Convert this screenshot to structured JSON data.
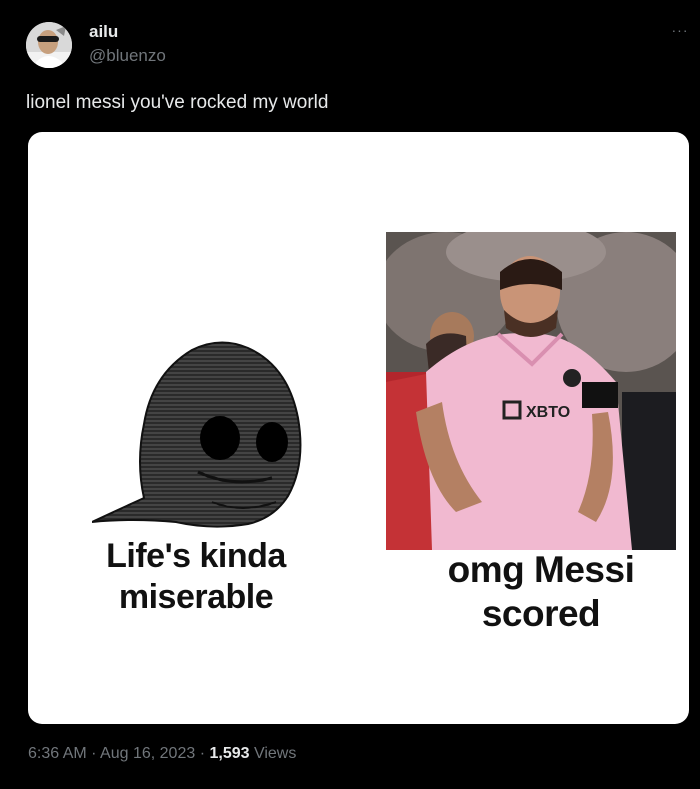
{
  "author": {
    "display_name": "ailu",
    "handle": "@bluenzo",
    "avatar_icon": "avatar-photo"
  },
  "menu": {
    "more_label": "···"
  },
  "tweet": {
    "text": "lionel messi you've rocked my world"
  },
  "media": {
    "left_caption_line1": "Life's kinda",
    "left_caption_line2": "miserable",
    "right_caption_line1": "omg Messi",
    "right_caption_line2": "scored",
    "jersey_sponsor": "XBTO"
  },
  "meta": {
    "time": "6:36 AM",
    "separator": " · ",
    "date": "Aug 16, 2023",
    "views_count": "1,593",
    "views_label": " Views"
  },
  "colors": {
    "background": "#000000",
    "primary_text": "#e7e9ea",
    "secondary_text": "#71767b",
    "jersey_pink": "#f1b9d0"
  }
}
